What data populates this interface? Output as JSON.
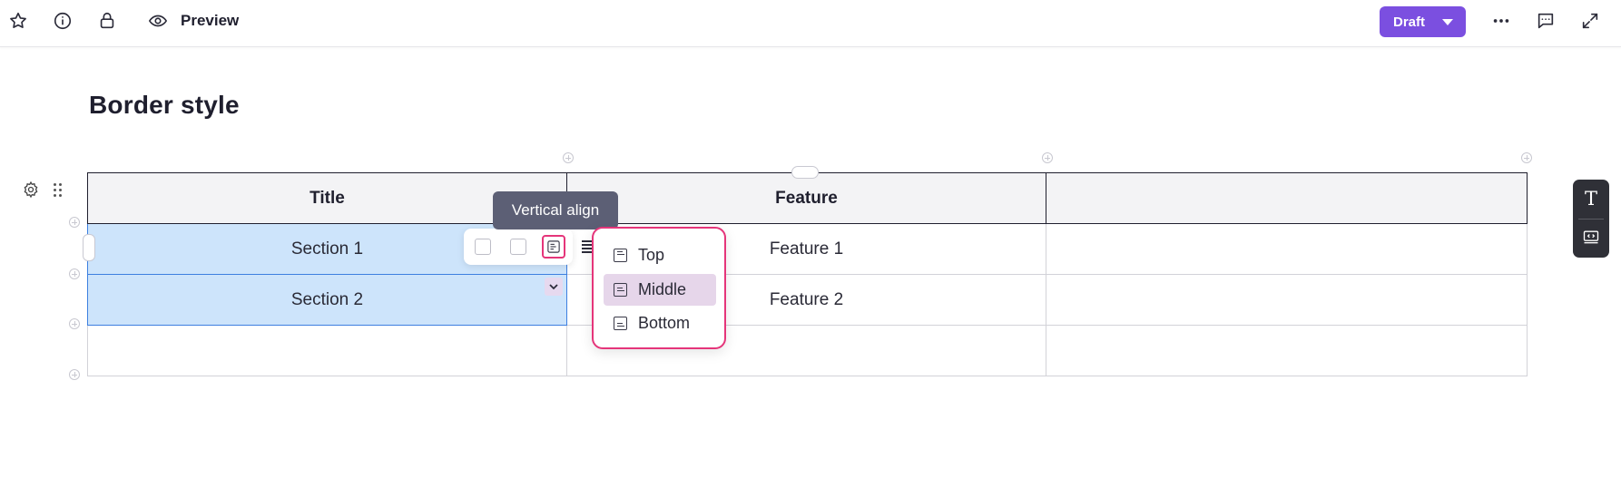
{
  "topbar": {
    "preview_label": "Preview",
    "draft_label": "Draft",
    "draft_color": "#7b4fe0",
    "icons": [
      "star-icon",
      "info-icon",
      "lock-icon",
      "eye-icon",
      "more-icon",
      "comment-icon",
      "expand-icon"
    ]
  },
  "page": {
    "title": "Border style"
  },
  "table": {
    "headers": [
      "Title",
      "Feature",
      ""
    ],
    "rows": [
      [
        "Section 1",
        "Feature 1",
        ""
      ],
      [
        "Section 2",
        "Feature 2",
        ""
      ],
      [
        "",
        "",
        ""
      ]
    ]
  },
  "tooltip": {
    "text": "Vertical align"
  },
  "vertical_align_menu": {
    "items": [
      {
        "label": "Top",
        "active": false
      },
      {
        "label": "Middle",
        "active": true
      },
      {
        "label": "Bottom",
        "active": false
      }
    ],
    "accent_color": "#e5357a"
  },
  "side_panel": {
    "text_tool_glyph": "T",
    "icons": [
      "text-icon",
      "embed-icon"
    ]
  }
}
